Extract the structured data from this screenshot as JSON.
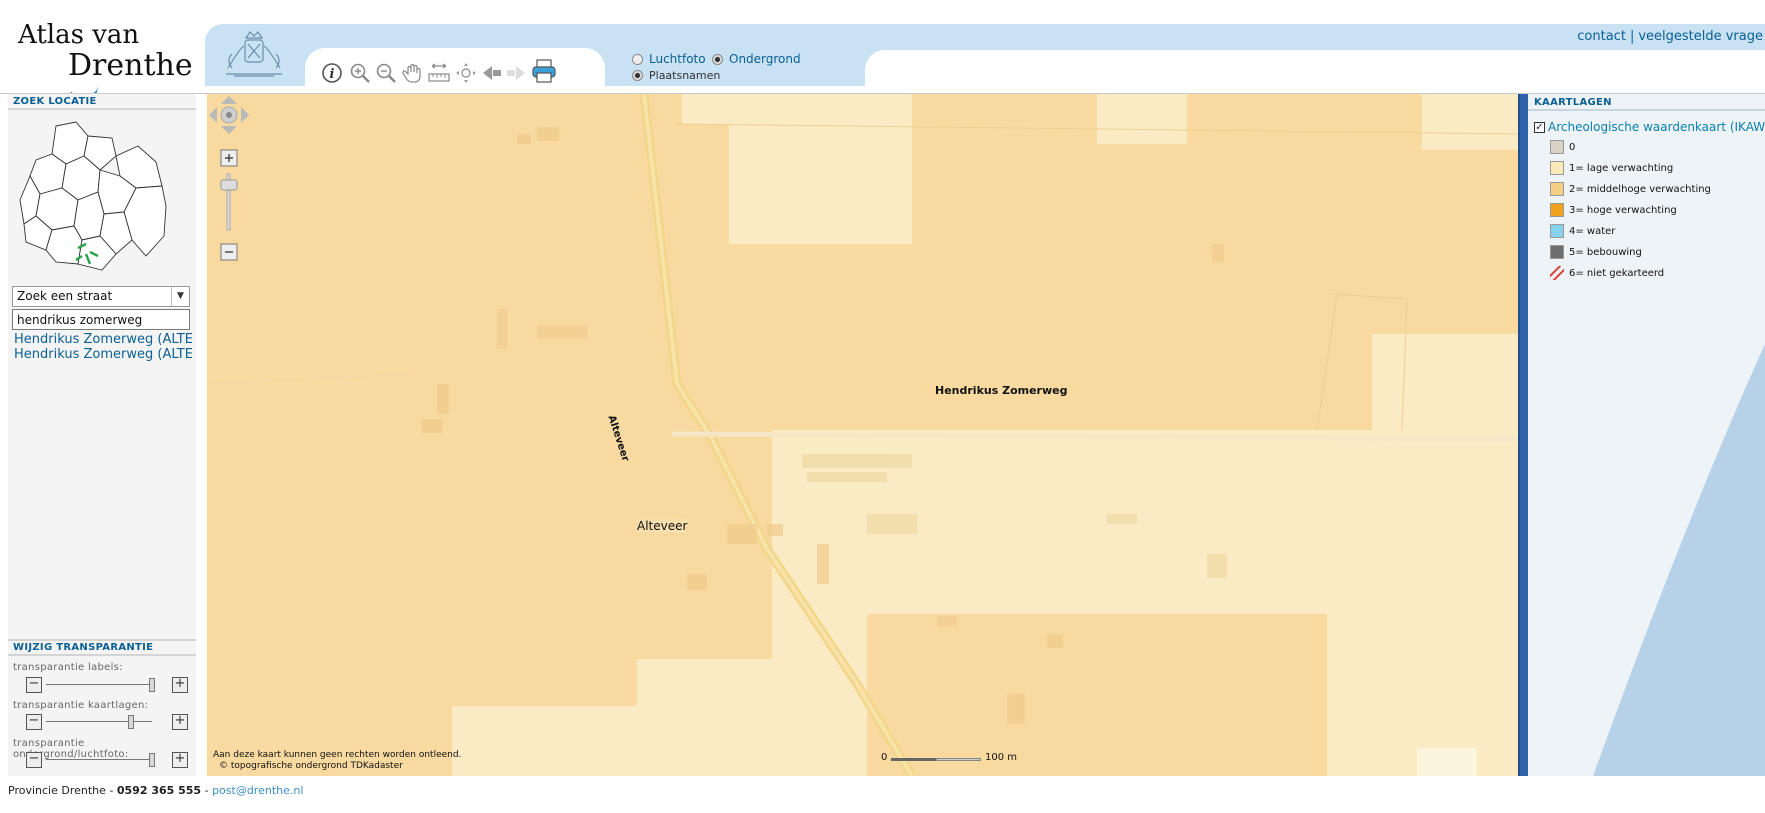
{
  "header": {
    "logo_line1": "Atlas van",
    "logo_line2": "Drenthe",
    "links": [
      "contact",
      "veelgestelde vrage"
    ],
    "link_separator": "|",
    "basemaps": [
      {
        "label": "Luchtfoto",
        "selected": false
      },
      {
        "label": "Ondergrond",
        "selected": true
      },
      {
        "label": "Plaatsnamen",
        "selected": true
      }
    ],
    "tools": [
      "info-icon",
      "zoom-in-icon",
      "zoom-out-icon",
      "pan-hand-icon",
      "measure-icon",
      "full-extent-icon",
      "previous-extent-icon",
      "next-extent-icon",
      "print-icon"
    ]
  },
  "left": {
    "search_title": "ZOEK LOCATIE",
    "select_value": "Zoek een straat",
    "search_value": "hendrikus zomerweg",
    "results": [
      "Hendrikus Zomerweg (ALTEVEER)",
      "Hendrikus Zomerweg (ALTEVEER)"
    ],
    "transparency_title": "WIJZIG TRANSPARANTIE",
    "sliders": [
      {
        "label": "transparantie labels:",
        "value": 1.0
      },
      {
        "label": "transparantie kaartlagen:",
        "value": 0.8
      },
      {
        "label": "transparantie ondergrond/luchtfoto:",
        "value": 1.0
      }
    ]
  },
  "map": {
    "road_label_1": "Hendrikus Zomerweg",
    "road_label_2": "Alteveer",
    "place_label": "Alteveer",
    "disclaimer_1": "Aan deze kaart kunnen geen rechten worden ontleend.",
    "disclaimer_2": "© topografische ondergrond TDKadaster",
    "scale_start": "0",
    "scale_end": "100 m",
    "colors": {
      "zone2": "#f8d9a0",
      "zone1": "#fbebc4",
      "light": "#fdf4dc"
    }
  },
  "right": {
    "title": "KAARTLAGEN",
    "layer_title": "Archeologische waardenkaart (IKAW)",
    "layer_checked": true,
    "legend": [
      {
        "label": "0",
        "color": "#d8d2c8"
      },
      {
        "label": "1= lage verwachting",
        "color": "#fbe9b8"
      },
      {
        "label": "2= middelhoge verwachting",
        "color": "#f6cf86"
      },
      {
        "label": "3= hoge verwachting",
        "color": "#f0a31c"
      },
      {
        "label": "4= water",
        "color": "#86d3f0"
      },
      {
        "label": "5= bebouwing",
        "color": "#6e6e6e"
      },
      {
        "label": "6= niet gekarteerd",
        "color": "#ffffff"
      }
    ]
  },
  "footer": {
    "org": "Provincie Drenthe -",
    "phone": "0592 365 555",
    "dash": "-",
    "email": "post@drenthe.nl"
  }
}
